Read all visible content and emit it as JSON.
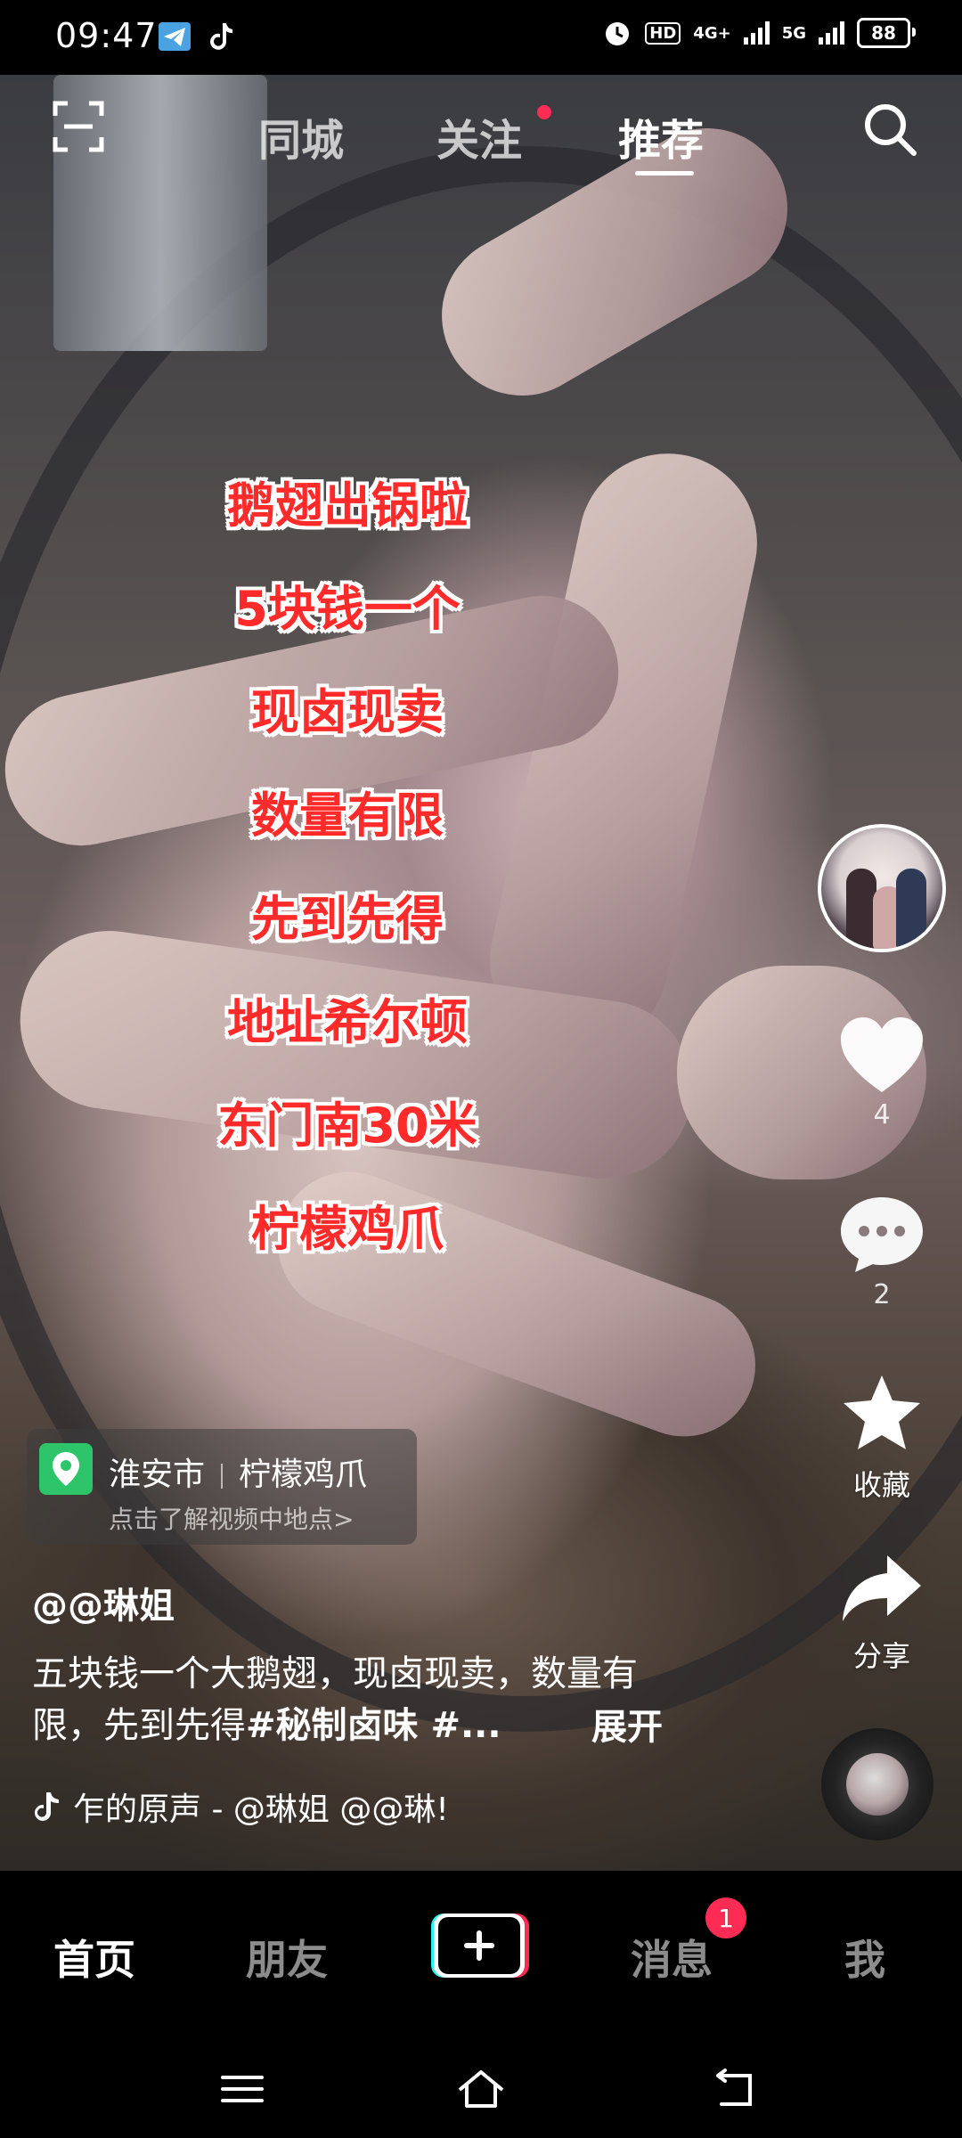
{
  "status_bar": {
    "time": "09:47",
    "left_icons": [
      "telegram-icon",
      "tiktok-icon"
    ],
    "right_icons": [
      "alarm-icon",
      "hd-icon",
      "signal-4g-icon",
      "signal-5g-icon"
    ],
    "network_1": "4G+",
    "network_2": "5G",
    "hd": "HD",
    "battery": "88"
  },
  "top_nav": {
    "tabs": [
      {
        "label": "同城",
        "active": false
      },
      {
        "label": "关注",
        "active": false,
        "dot": true
      },
      {
        "label": "推荐",
        "active": true
      }
    ],
    "left_icon": "scan-icon",
    "right_icon": "search-icon"
  },
  "overlay_text": [
    "鹅翅出锅啦",
    "5块钱一个",
    "现卤现卖",
    "数量有限",
    "先到先得",
    "地址希尔顿",
    "东门南30米",
    "柠檬鸡爪"
  ],
  "actions": {
    "like_count": "4",
    "comment_count": "2",
    "favorite_label": "收藏",
    "share_label": "分享"
  },
  "location": {
    "city": "淮安市",
    "place": "柠檬鸡爪",
    "hint": "点击了解视频中地点>"
  },
  "post": {
    "author": "@@琳姐",
    "description_plain": "五块钱一个大鹅翅，现卤现卖，数量有限，先到先得",
    "description_tags": "#秘制卤味 #...",
    "expand_label": "展开",
    "music_text": "乍的原声 - @琳姐    @@琳!"
  },
  "bottom_nav": {
    "items": [
      {
        "label": "首页",
        "active": true
      },
      {
        "label": "朋友",
        "active": false
      },
      {
        "label": "消息",
        "active": false
      },
      {
        "label": "我",
        "active": false
      }
    ],
    "message_badge": "1"
  },
  "colors": {
    "overlay_red": "#ff2b2b",
    "accent_pink": "#fe2c55",
    "location_green": "#2ec56a"
  }
}
